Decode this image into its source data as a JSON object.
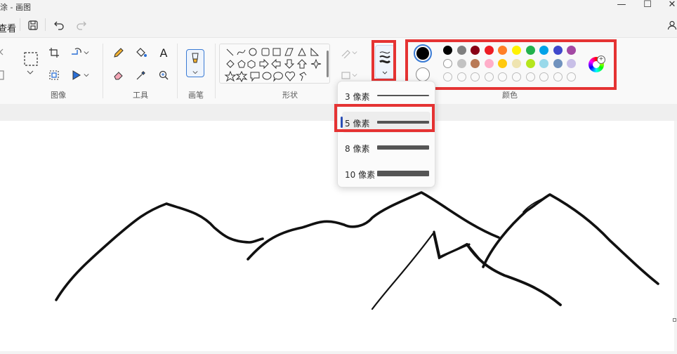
{
  "window": {
    "title": "涂 - 画图",
    "minimize": "—",
    "maximize": "☐",
    "close": "✕"
  },
  "menu": {
    "view_label": "查看"
  },
  "ribbon": {
    "groups": {
      "image": "图像",
      "tools": "工具",
      "brushes": "画笔",
      "shapes": "形状",
      "colors": "颜色"
    },
    "tools_text_glyph": "A"
  },
  "stroke_menu": {
    "items": [
      {
        "label": "3 像素",
        "thickness": 3,
        "selected": false
      },
      {
        "label": "5 像素",
        "thickness": 5,
        "selected": true
      },
      {
        "label": "8 像素",
        "thickness": 8,
        "selected": false
      },
      {
        "label": "10 像素",
        "thickness": 10,
        "selected": false
      }
    ]
  },
  "colors": {
    "primary": "#000000",
    "secondary": "#ffffff",
    "palette_row1": [
      "#000000",
      "#7f7f7f",
      "#880015",
      "#ed1c24",
      "#ff7f27",
      "#fff200",
      "#22b14c",
      "#00a2e8",
      "#3f48cc",
      "#a349a4"
    ],
    "palette_row2": [
      "#ffffff",
      "#c3c3c3",
      "#b97a57",
      "#ffaec9",
      "#ffc90e",
      "#efe4b0",
      "#b5e61d",
      "#99d9ea",
      "#7092be",
      "#c8bfe7"
    ],
    "highlight_red": "#e53333"
  }
}
